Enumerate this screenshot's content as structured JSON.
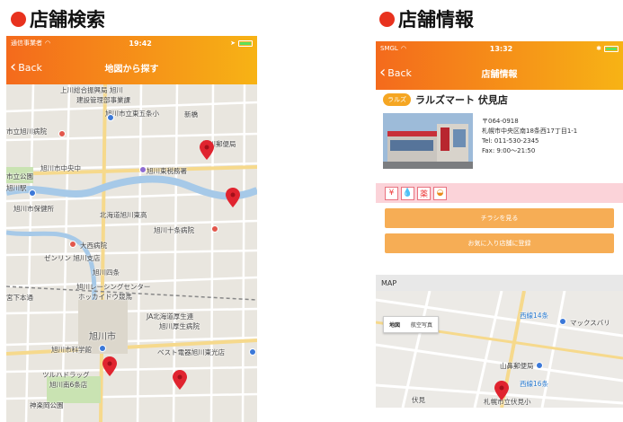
{
  "panel_left": {
    "title": "店舗検索"
  },
  "panel_right": {
    "title": "店舗情報"
  },
  "phone1": {
    "status": {
      "carrier": "通信事業者",
      "time": "19:42"
    },
    "nav": {
      "back": "Back",
      "title": "地図から探す"
    },
    "map_labels": {
      "l1": "上川総合振興局 旭川",
      "l2": "建設管理部事業課",
      "l3": "旭川市立東五条小",
      "l4": "市立旭川病院",
      "l5": "旭川郵便局",
      "l6": "旭川市中央中",
      "l7": "旭川東税務署",
      "l8": "旭川市保健所",
      "l9": "北海道旭川東高",
      "l10": "旭川十条病院",
      "l11": "大西病院",
      "l12": "ゼンリン 旭川支店",
      "l13": "旭川レーシングセンター",
      "l14": "ホッカイドウ競馬",
      "l15": "JA北海道厚生連",
      "l16": "旭川厚生病院",
      "l17": "旭川市",
      "l18": "旭川市科学館",
      "l19": "ベスト電器旭川東光店",
      "l20": "ツルハドラッグ",
      "l21": "旭川南6条店",
      "l22": "神楽岡公園",
      "l23": "新橋",
      "l24": "市立公園",
      "l25": "旭川駅",
      "l26": "旭川四条",
      "l27": "宮下本通"
    }
  },
  "phone2": {
    "status": {
      "carrier": "SMGL",
      "time": "13:32"
    },
    "nav": {
      "back": "Back",
      "title": "店舗情報"
    },
    "store": {
      "badge": "ラルズ",
      "name": "ラルズマート 伏見店",
      "postal": "〒064-0918",
      "address": "札幌市中央区南18条西17丁目1-1",
      "tel": "Tel: 011-530-2345",
      "hours": "Fax: 9:00〜21:50"
    },
    "buttons": {
      "flyer": "チラシを見る",
      "favorite": "お気に入り店舗に登録"
    },
    "map_heading": "MAP",
    "map_types": {
      "map": "地図",
      "satellite": "航空写真"
    },
    "map_labels": {
      "m1": "西線14条",
      "m2": "マックスバリ",
      "m3": "山鼻郵便局",
      "m4": "西線16条",
      "m5": "伏見",
      "m6": "札幌市立伏見小"
    }
  },
  "colors": {
    "accent_start": "#f46a1c",
    "accent_end": "#f7b315",
    "pin": "#e0242f",
    "button": "#f6a94c"
  }
}
